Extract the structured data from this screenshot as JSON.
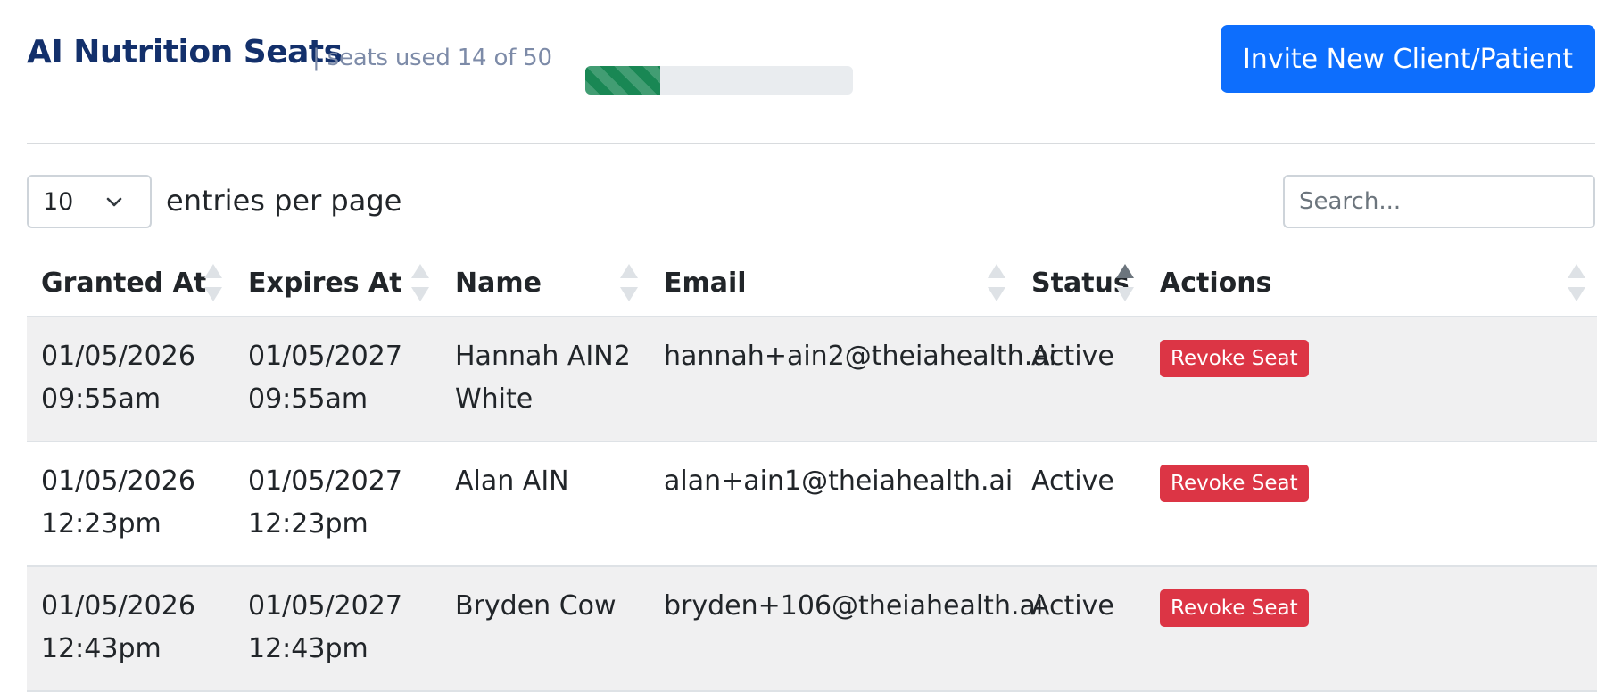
{
  "header": {
    "title": "AI Nutrition Seats",
    "subtitle": "| seats used 14 of 50",
    "seats_used": 14,
    "seats_total": 50,
    "invite_label": "Invite New Client/Patient"
  },
  "controls": {
    "per_page_value": "10",
    "per_page_label": "entries per page",
    "search_placeholder": "Search..."
  },
  "table": {
    "columns": [
      "Granted At",
      "Expires At",
      "Name",
      "Email",
      "Status",
      "Actions"
    ],
    "sorted_column": "Status",
    "sort_direction": "ascending",
    "rows": [
      {
        "granted": [
          "01/05/2026",
          "09:55am"
        ],
        "expires": [
          "01/05/2027",
          "09:55am"
        ],
        "name": [
          "Hannah AIN2",
          "White"
        ],
        "email": "hannah+ain2@theiahealth.ai",
        "status": "Active",
        "action": "Revoke Seat"
      },
      {
        "granted": [
          "01/05/2026",
          "12:23pm"
        ],
        "expires": [
          "01/05/2027",
          "12:23pm"
        ],
        "name": [
          "Alan AIN",
          ""
        ],
        "email": "alan+ain1@theiahealth.ai",
        "status": "Active",
        "action": "Revoke Seat"
      },
      {
        "granted": [
          "01/05/2026",
          "12:43pm"
        ],
        "expires": [
          "01/05/2027",
          "12:43pm"
        ],
        "name": [
          "Bryden Cow",
          ""
        ],
        "email": "bryden+106@theiahealth.ai",
        "status": "Active",
        "action": "Revoke Seat"
      }
    ]
  },
  "colors": {
    "title": "#13306b",
    "primary": "#0d6efd",
    "progress": "#198754",
    "danger": "#dc3545"
  }
}
